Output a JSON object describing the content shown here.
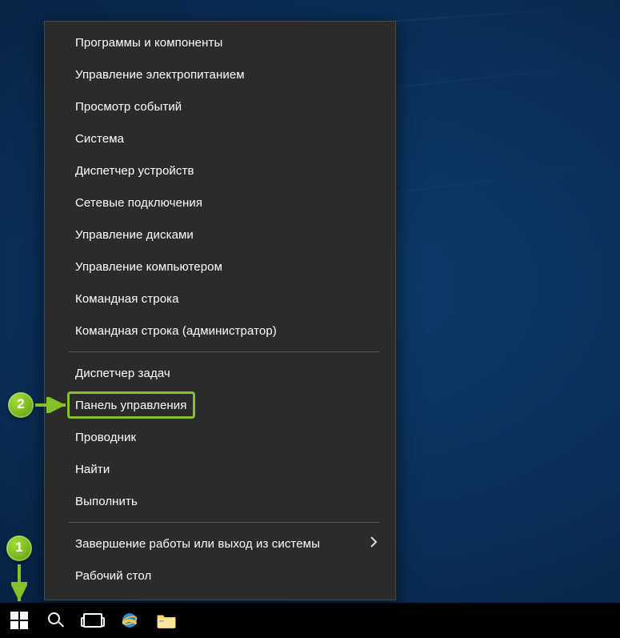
{
  "annotations": {
    "step1": "1",
    "step2": "2"
  },
  "power_menu": {
    "items": [
      {
        "label": "Программы и компоненты"
      },
      {
        "label": "Управление электропитанием"
      },
      {
        "label": "Просмотр событий"
      },
      {
        "label": "Система"
      },
      {
        "label": "Диспетчер устройств"
      },
      {
        "label": "Сетевые подключения"
      },
      {
        "label": "Управление дисками"
      },
      {
        "label": "Управление компьютером"
      },
      {
        "label": "Командная строка"
      },
      {
        "label": "Командная строка (администратор)"
      }
    ],
    "items_group2": [
      {
        "label": "Диспетчер задач"
      },
      {
        "label": "Панель управления",
        "highlighted": true
      },
      {
        "label": "Проводник"
      },
      {
        "label": "Найти"
      },
      {
        "label": "Выполнить"
      }
    ],
    "items_group3": [
      {
        "label": "Завершение работы или выход из системы",
        "has_submenu": true
      },
      {
        "label": "Рабочий стол"
      }
    ]
  },
  "taskbar": {
    "icons": {
      "start": "start-icon",
      "search": "search-icon",
      "taskview": "task-view-icon",
      "ie": "internet-explorer-icon",
      "explorer": "file-explorer-icon"
    }
  },
  "colors": {
    "accent": "#85c227",
    "menu_bg": "#2b2b2b",
    "menu_border": "#4a4a4a"
  }
}
